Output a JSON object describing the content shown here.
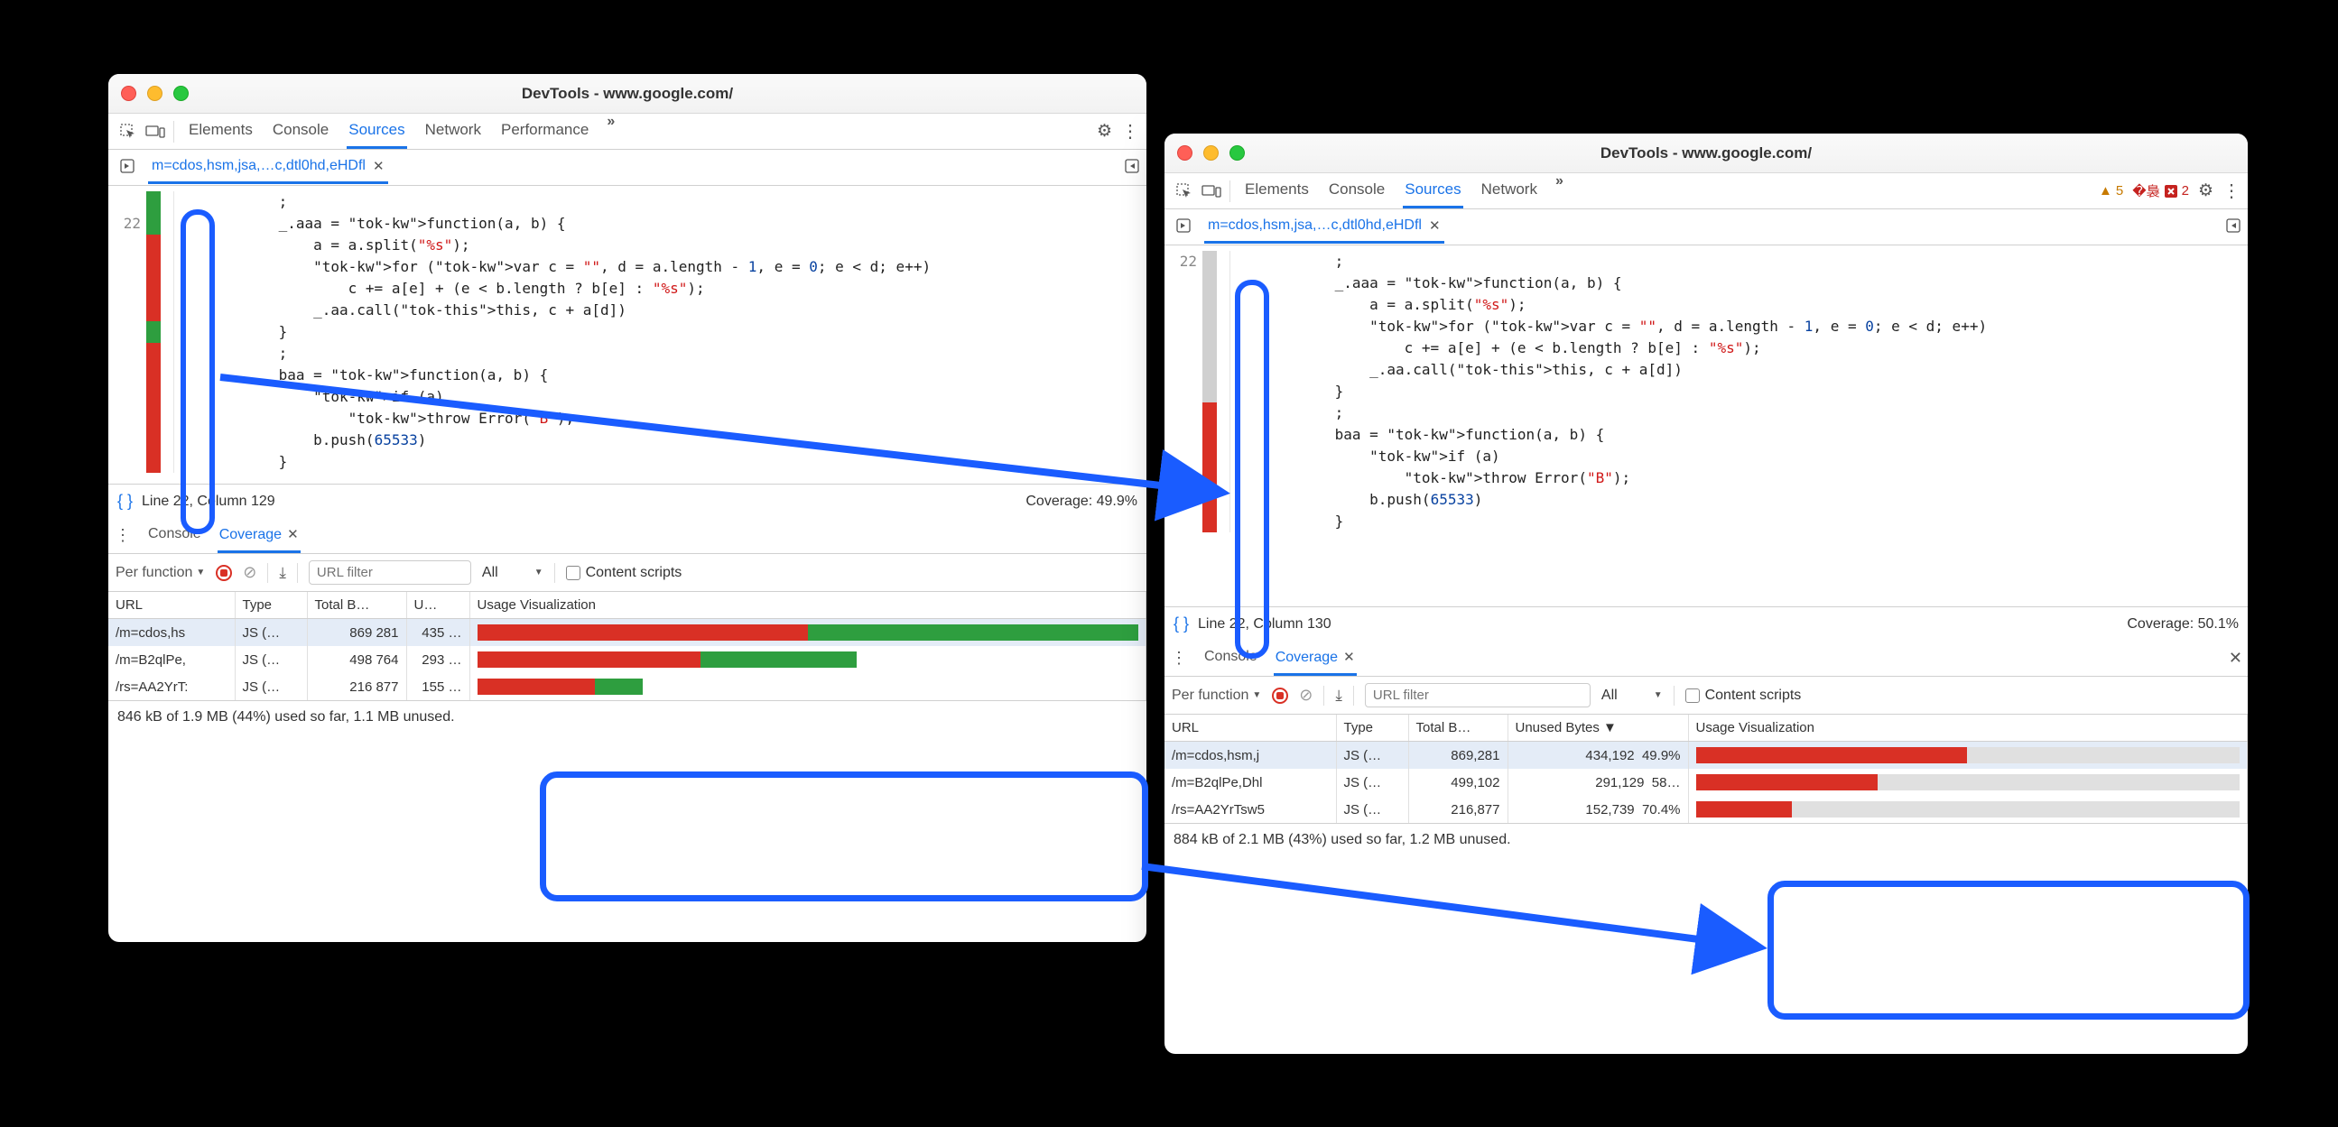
{
  "left": {
    "title": "DevTools - www.google.com/",
    "tabs": [
      "Elements",
      "Console",
      "Sources",
      "Network",
      "Performance"
    ],
    "active_tab": "Sources",
    "more": "»",
    "file_tab": "m=cdos,hsm,jsa,…c,dtl0hd,eHDfl",
    "line_no": "22",
    "status": {
      "pos": "Line 22, Column 129",
      "coverage": "Coverage: 49.9%"
    },
    "drawer": {
      "tabs": [
        "Console",
        "Coverage"
      ],
      "active": "Coverage",
      "perfunc": "Per function",
      "url_placeholder": "URL filter",
      "type_filter": "All",
      "content_scripts": "Content scripts",
      "cols": [
        "URL",
        "Type",
        "Total B…",
        "U…",
        "Usage Visualization"
      ],
      "rows": [
        {
          "url": "/m=cdos,hs",
          "type": "JS (…",
          "total": "869 281",
          "unused": "435 …",
          "rel": 1.0,
          "unused_pct": 0.5
        },
        {
          "url": "/m=B2qlPe,",
          "type": "JS (…",
          "total": "498 764",
          "unused": "293 …",
          "rel": 0.574,
          "unused_pct": 0.588
        },
        {
          "url": "/rs=AA2YrT:",
          "type": "JS (…",
          "total": "216 877",
          "unused": "155 …",
          "rel": 0.25,
          "unused_pct": 0.715
        }
      ],
      "footer": "846 kB of 1.9 MB (44%) used so far, 1.1 MB unused."
    }
  },
  "right": {
    "title": "DevTools - www.google.com/",
    "tabs": [
      "Elements",
      "Console",
      "Sources",
      "Network"
    ],
    "active_tab": "Sources",
    "more": "»",
    "warnings": "5",
    "errors": "2",
    "file_tab": "m=cdos,hsm,jsa,…c,dtl0hd,eHDfl",
    "line_no": "22",
    "status": {
      "pos": "Line 22, Column 130",
      "coverage": "Coverage: 50.1%"
    },
    "drawer": {
      "tabs": [
        "Console",
        "Coverage"
      ],
      "active": "Coverage",
      "perfunc": "Per function",
      "url_placeholder": "URL filter",
      "type_filter": "All",
      "content_scripts": "Content scripts",
      "cols": [
        "URL",
        "Type",
        "Total B…",
        "Unused Bytes ▼",
        "Usage Visualization"
      ],
      "rows": [
        {
          "url": "/m=cdos,hsm,j",
          "type": "JS (…",
          "total": "869,281",
          "unused": "434,192",
          "pct": "49.9%",
          "rel": 1.0,
          "unused_pct": 0.499
        },
        {
          "url": "/m=B2qlPe,Dhl",
          "type": "JS (…",
          "total": "499,102",
          "unused": "291,129",
          "pct": "58…",
          "rel": 0.574,
          "unused_pct": 0.583
        },
        {
          "url": "/rs=AA2YrTsw5",
          "type": "JS (…",
          "total": "216,877",
          "unused": "152,739",
          "pct": "70.4%",
          "rel": 0.25,
          "unused_pct": 0.704
        }
      ],
      "footer": "884 kB of 2.1 MB (43%) used so far, 1.2 MB unused."
    }
  },
  "code": {
    "lines": [
      "            ;",
      "            _.aaa = function(a, b) {",
      "                a = a.split(\"%s\");",
      "                for (var c = \"\", d = a.length - 1, e = 0; e < d; e++)",
      "                    c += a[e] + (e < b.length ? b[e] : \"%s\");",
      "                _.aa.call(this, c + a[d])",
      "            }",
      "            ;",
      "            baa = function(a, b) {",
      "                if (a)",
      "                    throw Error(\"B\");",
      "                b.push(65533)",
      "            }"
    ]
  }
}
